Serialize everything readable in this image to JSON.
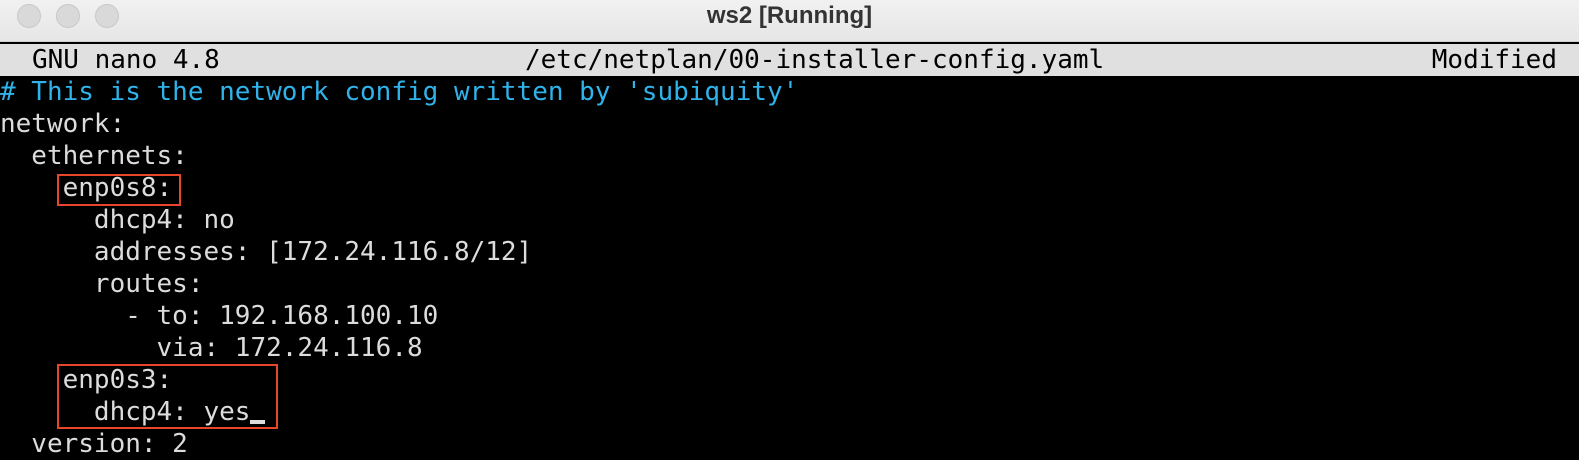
{
  "window": {
    "title": "ws2 [Running]"
  },
  "nano": {
    "version": "GNU nano 4.8",
    "filename": "/etc/netplan/00-installer-config.yaml",
    "status": "Modified"
  },
  "file": {
    "lines": [
      "# This is the network config written by 'subiquity'",
      "network:",
      "  ethernets:",
      "    enp0s8:",
      "      dhcp4: no",
      "      addresses: [172.24.116.8/12]",
      "      routes:",
      "        - to: 192.168.100.10",
      "          via: 172.24.116.8",
      "    enp0s3:",
      "      dhcp4: yes",
      "  version: 2"
    ]
  },
  "colors": {
    "comment": "#2fb3ea",
    "highlight_box": "#e8462a",
    "header_bg": "#e0e0e0"
  }
}
